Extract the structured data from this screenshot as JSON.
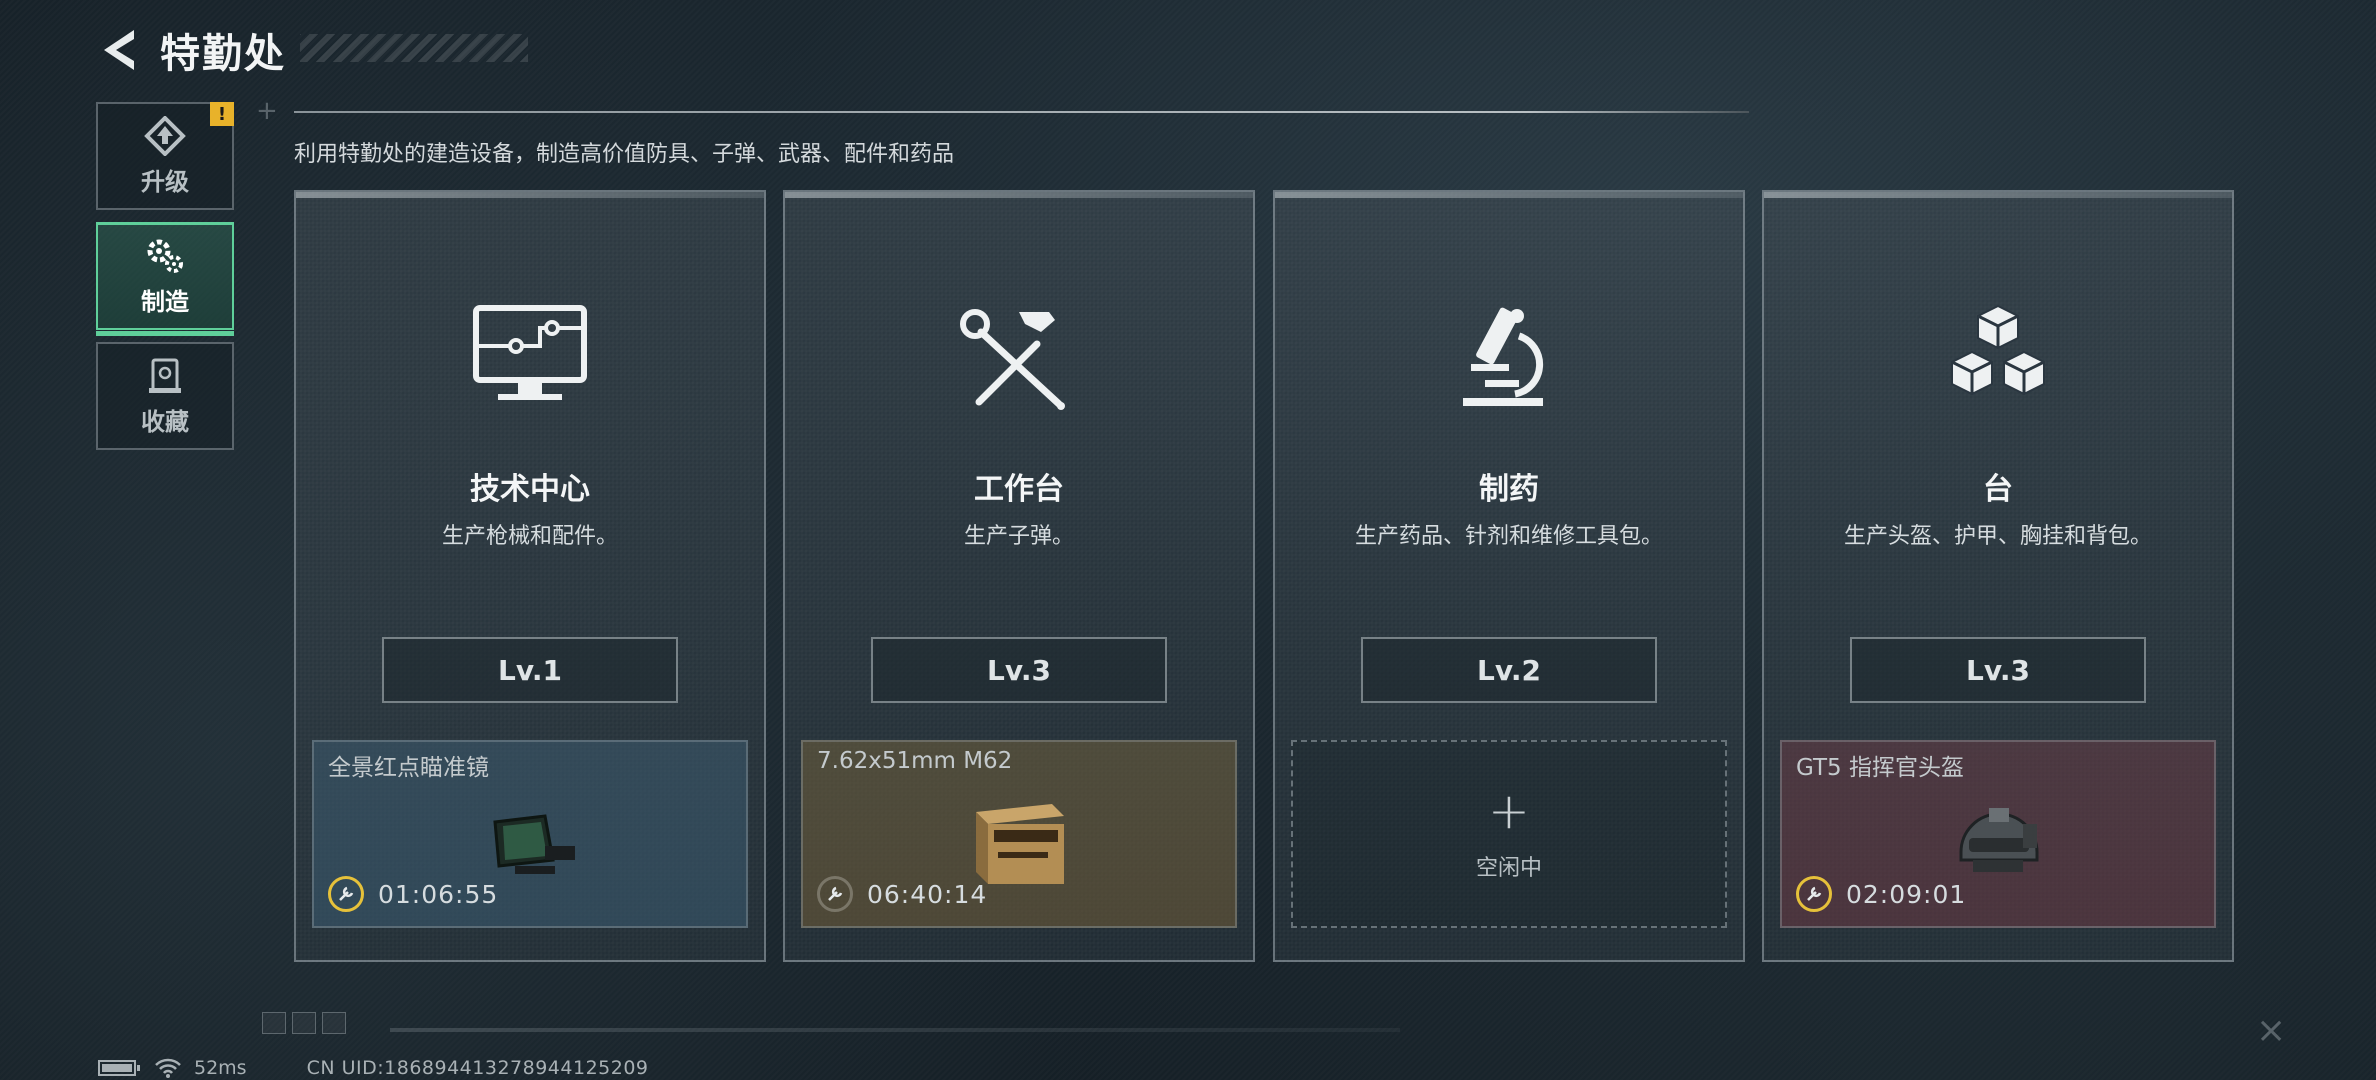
{
  "header": {
    "title": "特勤处",
    "subtitle": "利用特勤处的建造设备，制造高价值防具、子弹、武器、配件和药品"
  },
  "sidenav": {
    "items": [
      {
        "label": "升级",
        "icon": "upgrade-icon",
        "badge": "!"
      },
      {
        "label": "制造",
        "icon": "gears-icon",
        "active": true
      },
      {
        "label": "收藏",
        "icon": "collection-icon"
      }
    ]
  },
  "cards": [
    {
      "title": "技术中心",
      "desc": "生产枪械和配件。",
      "level": "Lv.1",
      "icon": "monitor-circuit-icon",
      "slot": {
        "item": "全景红点瞄准镜",
        "timer": "01:06:55",
        "color": "#3c5a6e"
      }
    },
    {
      "title": "工作台",
      "desc": "生产子弹。",
      "level": "Lv.3",
      "icon": "hammer-wrench-icon",
      "slot": {
        "item": "7.62x51mm M62",
        "timer": "06:40:14",
        "color": "#6e5f3c"
      }
    },
    {
      "title": "制药",
      "desc": "生产药品、针剂和维修工具包。",
      "level": "Lv.2",
      "icon": "microscope-icon",
      "slot": {
        "idle_label": "空闲中",
        "plus": "+"
      }
    },
    {
      "title": "台",
      "desc": "生产头盔、护甲、胸挂和背包。",
      "level": "Lv.3",
      "icon": "cubes-icon",
      "slot": {
        "item": "GT5 指挥官头盔",
        "timer": "02:09:01",
        "color": "#6e3c46"
      }
    }
  ],
  "status_bar": {
    "ping": "52ms",
    "uid": "CN UID:186894413278944125209"
  },
  "colors": {
    "accent_green": "#5fcf9a",
    "badge_yellow": "#e8b22a",
    "timer_yellow": "#e6c13a"
  }
}
